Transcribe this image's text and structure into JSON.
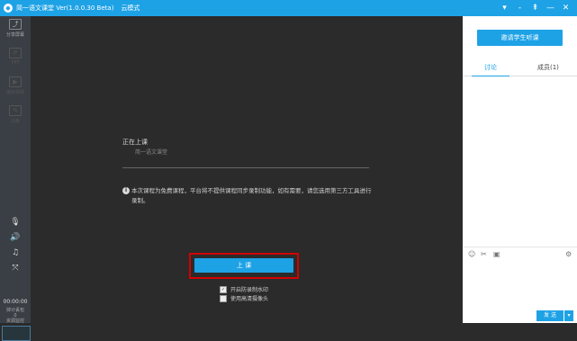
{
  "window": {
    "title": "简一语文课堂 Ver(1.0.0.30 Beta)",
    "mode": "云模式",
    "controls": [
      "▾",
      "‑",
      "⇞",
      "—",
      "✕"
    ]
  },
  "left_toolbar": {
    "tools": [
      {
        "label": "分享屏幕",
        "icon": "⤴"
      },
      {
        "label": "PPT",
        "icon": "P"
      },
      {
        "label": "播放视频",
        "icon": "▶"
      },
      {
        "label": "白板",
        "icon": "✎"
      }
    ],
    "time": "00:00:00",
    "stats": [
      "掉计丢包",
      "0",
      "资源监控"
    ]
  },
  "stage": {
    "status_title": "正在上课",
    "course_name": "简一语文课堂",
    "notice": "本次课程为免费课程，平台将不提供课程同步录制功能，如有需要，请您选用第三方工具进行录制。",
    "start_button": "上 课",
    "options": [
      {
        "label": "开启防录制水印",
        "checked": true
      },
      {
        "label": "使用高清摄像头",
        "checked": false
      }
    ]
  },
  "right_panel": {
    "invite_button": "邀请学生听课",
    "tabs": [
      "讨论",
      "成员(1)"
    ],
    "send_button": "发 送"
  },
  "colors": {
    "accent": "#1ea2e6",
    "highlight": "#d40000",
    "stage_bg": "#2b2b2b"
  }
}
